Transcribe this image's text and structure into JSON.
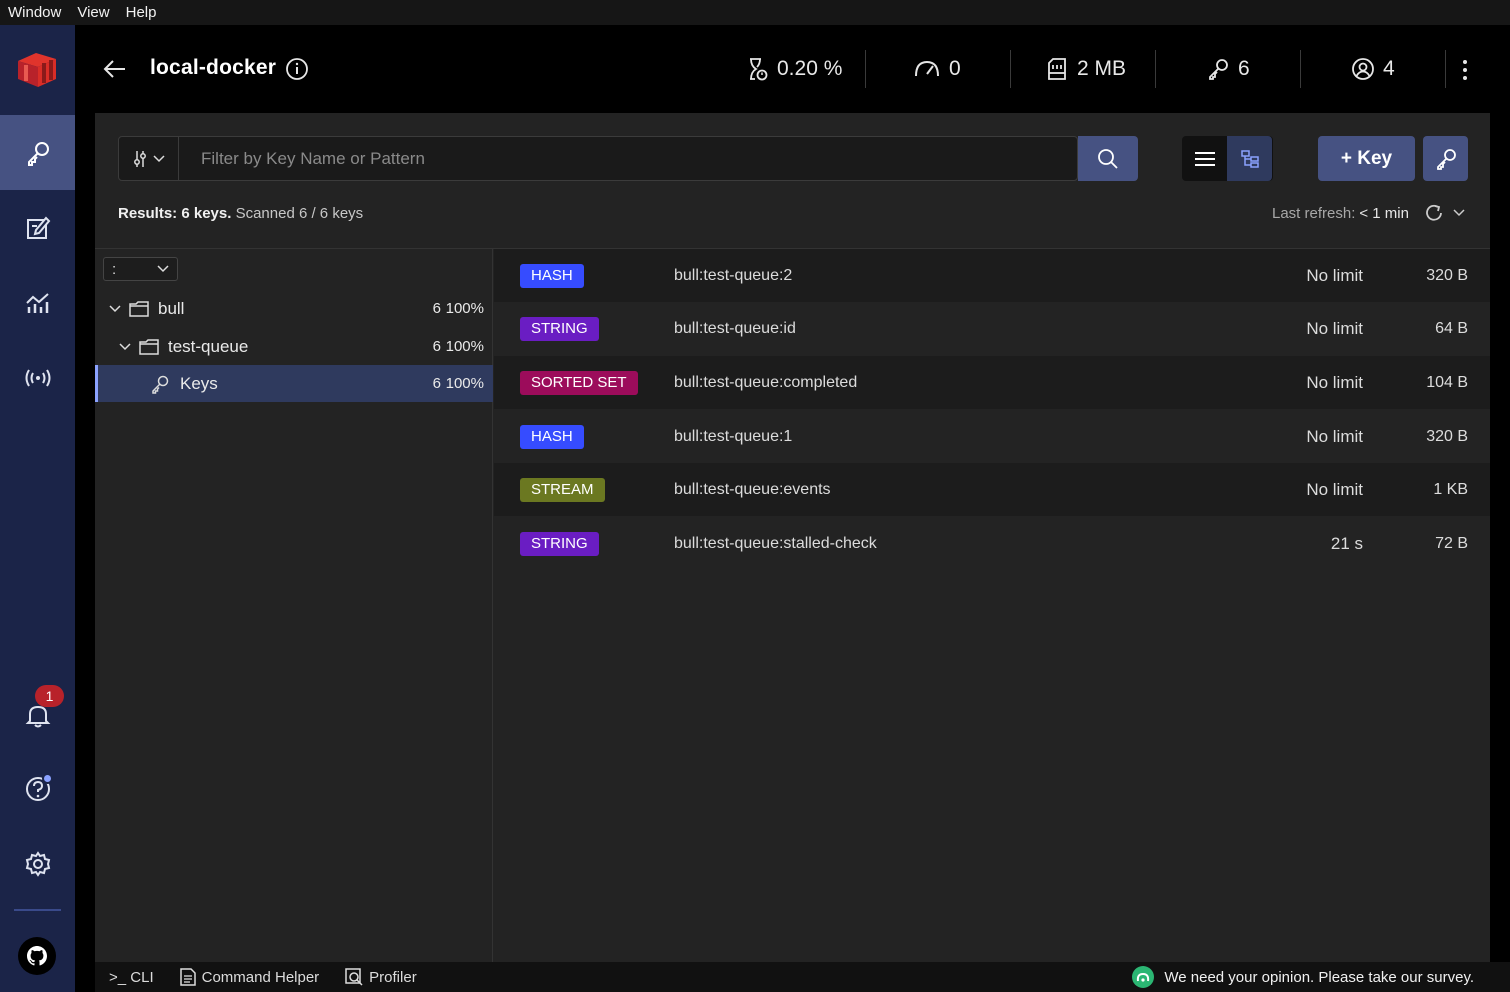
{
  "menu": [
    "Window",
    "View",
    "Help"
  ],
  "header": {
    "db_name": "local-docker",
    "cpu": "0.20 %",
    "ops": "0",
    "memory": "2 MB",
    "keys": "6",
    "clients": "4"
  },
  "sidebar": {
    "items": [
      "browser",
      "workbench",
      "analytics",
      "pubsub"
    ],
    "notifications_count": "1"
  },
  "filter": {
    "placeholder": "Filter by Key Name or Pattern"
  },
  "actions": {
    "add_key_label": "+ Key"
  },
  "results": {
    "prefix": "Results: 6 keys.",
    "scanned": "Scanned 6 / 6 keys",
    "last_refresh_label": "Last refresh:",
    "last_refresh_value": "< 1 min"
  },
  "tree": {
    "delimiter": ":",
    "nodes": [
      {
        "label": "bull",
        "count": "6",
        "percent": "100%"
      },
      {
        "label": "test-queue",
        "count": "6",
        "percent": "100%"
      },
      {
        "label": "Keys",
        "count": "6",
        "percent": "100%"
      }
    ]
  },
  "keys": [
    {
      "type": "HASH",
      "color": "#364cff",
      "name": "bull:test-queue:2",
      "ttl": "No limit",
      "size": "320 B"
    },
    {
      "type": "STRING",
      "color": "#6a1dc3",
      "name": "bull:test-queue:id",
      "ttl": "No limit",
      "size": "64 B"
    },
    {
      "type": "SORTED SET",
      "color": "#9c0c5b",
      "name": "bull:test-queue:completed",
      "ttl": "No limit",
      "size": "104 B"
    },
    {
      "type": "HASH",
      "color": "#364cff",
      "name": "bull:test-queue:1",
      "ttl": "No limit",
      "size": "320 B"
    },
    {
      "type": "STREAM",
      "color": "#6b7821",
      "name": "bull:test-queue:events",
      "ttl": "No limit",
      "size": "1 KB"
    },
    {
      "type": "STRING",
      "color": "#6a1dc3",
      "name": "bull:test-queue:stalled-check",
      "ttl": "21 s",
      "size": "72 B"
    }
  ],
  "bottom": {
    "cli": ">_ CLI",
    "command_helper": "Command Helper",
    "profiler": "Profiler",
    "survey": "We need your opinion. Please take our survey."
  }
}
